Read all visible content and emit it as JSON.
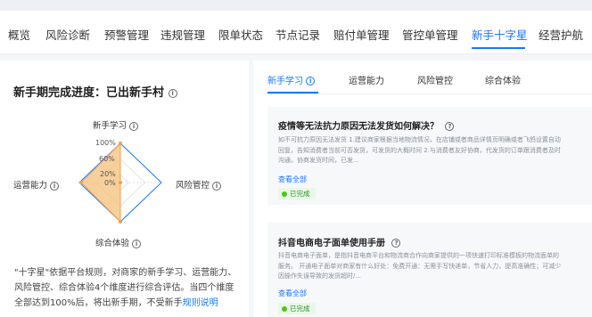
{
  "nav": {
    "tabs": [
      "概览",
      "风险诊断",
      "预警管理",
      "违规管理",
      "限单状态",
      "节点记录",
      "赔付单管理",
      "管控单管理",
      "新手十字星",
      "经营护航"
    ],
    "active_index": 8
  },
  "progress": {
    "title": "新手期完成进度：已出新手村",
    "radar": {
      "axes": [
        "新手学习",
        "风险管控",
        "综合体验",
        "运营能力"
      ],
      "values_percent": [
        100,
        0,
        100,
        100
      ],
      "scale_labels": [
        "100%",
        "60%",
        "20%",
        "0%"
      ]
    },
    "description": "\"十字星\"依据平台规则，对商家的新手学习、运营能力、风险管控、综合体验4个维度进行综合评估。当四个维度全部达到100%后，将出新手期，不受新手",
    "description_link": "规则说明"
  },
  "right_tabs": {
    "items": [
      "新手学习",
      "运营能力",
      "风险管控",
      "综合体验"
    ],
    "active_index": 0
  },
  "cards": [
    {
      "title": "疫情等无法抗力原因无法发货如何解决？",
      "body": "如不可抗力原因无法发货 1.建议商家根据当地物流情况，在店铺或者商品详情页明确或者飞鸽设置自动回复，告知消费者当前可否发货，可发货的大概时间 2.与消费者友好协商，代发货的订单跟消费者及时沟通，协商发货时间，已发...",
      "see_all": "查看全部",
      "status": "已完成"
    },
    {
      "title": "抖音电商电子面单使用手册",
      "body": "抖音电商电子面单，是指抖音电商平台和物流商合作向商家提供的一项快速打印标准模板的物流面单的服务。 开通电子面单对商家有什么好处：免费开通：无需手写快递单，节省人力，提高准确性；可减少因操作失误导致的发货超时/...",
      "see_all": "查看全部",
      "status": "已完成"
    }
  ],
  "colors": {
    "accent": "#1677ff",
    "radar_fill": "#f5c07a",
    "radar_stroke": "#f0a04b",
    "done_green": "#52c41a"
  }
}
